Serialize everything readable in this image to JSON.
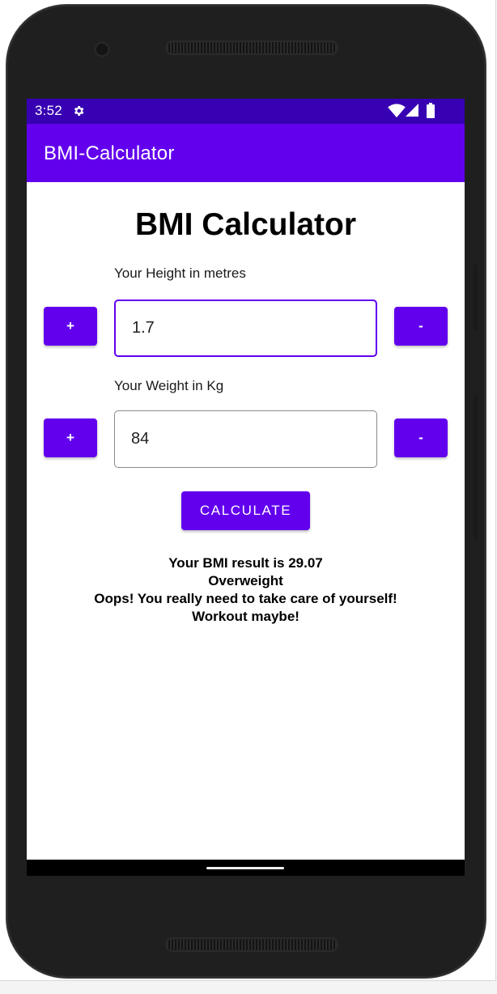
{
  "status_bar": {
    "time": "3:52",
    "icons": [
      "gear-icon",
      "wifi-icon",
      "cell-signal-icon",
      "battery-icon"
    ]
  },
  "app_bar": {
    "title": "BMI-Calculator"
  },
  "main": {
    "heading": "BMI Calculator",
    "height": {
      "label": "Your Height in metres",
      "value": "1.7",
      "increment_label": "+",
      "decrement_label": "-"
    },
    "weight": {
      "label": "Your Weight in Kg",
      "value": "84",
      "increment_label": "+",
      "decrement_label": "-"
    },
    "calculate_label": "CALCULATE",
    "result": {
      "bmi_line": "Your BMI result is 29.07",
      "category": "Overweight",
      "advice": "Oops! You really need to take care of yourself!",
      "suggestion": "Workout maybe!"
    }
  },
  "colors": {
    "status_bar": "#3700b3",
    "primary": "#6200ee",
    "on_primary": "#ffffff"
  }
}
